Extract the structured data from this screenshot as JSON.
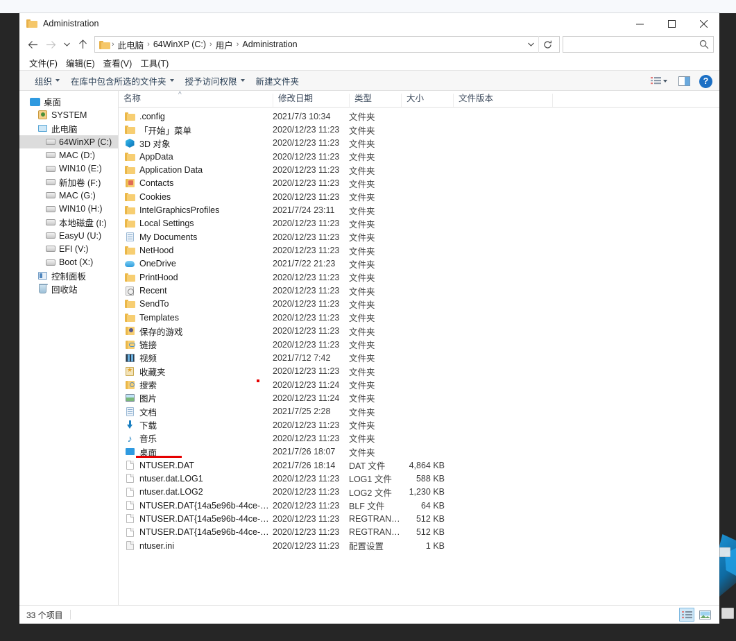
{
  "window": {
    "title": "Administration",
    "title_icon": "folder-icon",
    "controls": {
      "minimize": "minimize-icon",
      "maximize": "maximize-icon",
      "close": "close-icon"
    }
  },
  "address_bar": {
    "back": "back-arrow-icon",
    "forward": "forward-arrow-icon",
    "recent": "chevron-down-icon",
    "up": "up-arrow-icon",
    "breadcrumb": [
      "此电脑",
      "64WinXP (C:)",
      "用户",
      "Administration"
    ],
    "separator": "›",
    "dropdown": "chevron-down-icon",
    "refresh": "refresh-icon",
    "search": {
      "value": "",
      "placeholder": "",
      "icon": "search-icon"
    }
  },
  "menu_bar": [
    "文件(F)",
    "编辑(E)",
    "查看(V)",
    "工具(T)"
  ],
  "command_bar": {
    "items": [
      {
        "label": "组织",
        "has_caret": true
      },
      {
        "label": "在库中包含所选的文件夹",
        "has_caret": true
      },
      {
        "label": "授予访问权限",
        "has_caret": true
      },
      {
        "label": "新建文件夹",
        "has_caret": false
      }
    ],
    "right": {
      "view_options": "view-options-icon",
      "view_caret": "chevron-down-icon",
      "preview_pane": "preview-pane-icon",
      "help": "?"
    }
  },
  "nav_pane": {
    "items": [
      {
        "label": "桌面",
        "icon": "desktop-icon",
        "indent": 0,
        "selected": false
      },
      {
        "label": "SYSTEM",
        "icon": "user-icon",
        "indent": 1,
        "selected": false
      },
      {
        "label": "此电脑",
        "icon": "this-pc-icon",
        "indent": 1,
        "selected": false
      },
      {
        "label": "64WinXP  (C:)",
        "icon": "drive-icon",
        "indent": 2,
        "selected": true
      },
      {
        "label": "MAC (D:)",
        "icon": "drive-icon",
        "indent": 2,
        "selected": false
      },
      {
        "label": "WIN10 (E:)",
        "icon": "drive-icon",
        "indent": 2,
        "selected": false
      },
      {
        "label": "新加卷 (F:)",
        "icon": "drive-icon",
        "indent": 2,
        "selected": false
      },
      {
        "label": "MAC (G:)",
        "icon": "drive-icon",
        "indent": 2,
        "selected": false
      },
      {
        "label": "WIN10 (H:)",
        "icon": "drive-icon",
        "indent": 2,
        "selected": false
      },
      {
        "label": "本地磁盘 (I:)",
        "icon": "drive-icon",
        "indent": 2,
        "selected": false
      },
      {
        "label": "EasyU (U:)",
        "icon": "drive-icon",
        "indent": 2,
        "selected": false
      },
      {
        "label": "EFI (V:)",
        "icon": "drive-icon",
        "indent": 2,
        "selected": false
      },
      {
        "label": "Boot (X:)",
        "icon": "drive-icon",
        "indent": 2,
        "selected": false
      },
      {
        "label": "控制面板",
        "icon": "control-panel-icon",
        "indent": 1,
        "selected": false
      },
      {
        "label": "回收站",
        "icon": "recycle-bin-icon",
        "indent": 1,
        "selected": false
      }
    ]
  },
  "file_list": {
    "columns": [
      {
        "label": "名称",
        "sorted": true,
        "sort_caret": "^"
      },
      {
        "label": "修改日期",
        "sorted": false
      },
      {
        "label": "类型",
        "sorted": false
      },
      {
        "label": "大小",
        "sorted": false
      },
      {
        "label": "文件版本",
        "sorted": false
      }
    ],
    "rows": [
      {
        "name": ".config",
        "date": "2021/7/3 10:34",
        "type": "文件夹",
        "size": "",
        "version": "",
        "icon": "folder-icon"
      },
      {
        "name": "「开始」菜单",
        "date": "2020/12/23 11:23",
        "type": "文件夹",
        "size": "",
        "version": "",
        "icon": "folder-icon"
      },
      {
        "name": "3D 对象",
        "date": "2020/12/23 11:23",
        "type": "文件夹",
        "size": "",
        "version": "",
        "icon": "3d-objects-icon"
      },
      {
        "name": "AppData",
        "date": "2020/12/23 11:23",
        "type": "文件夹",
        "size": "",
        "version": "",
        "icon": "folder-icon"
      },
      {
        "name": "Application Data",
        "date": "2020/12/23 11:23",
        "type": "文件夹",
        "size": "",
        "version": "",
        "icon": "folder-icon"
      },
      {
        "name": "Contacts",
        "date": "2020/12/23 11:23",
        "type": "文件夹",
        "size": "",
        "version": "",
        "icon": "contacts-icon"
      },
      {
        "name": "Cookies",
        "date": "2020/12/23 11:23",
        "type": "文件夹",
        "size": "",
        "version": "",
        "icon": "folder-icon"
      },
      {
        "name": "IntelGraphicsProfiles",
        "date": "2021/7/24 23:11",
        "type": "文件夹",
        "size": "",
        "version": "",
        "icon": "folder-icon"
      },
      {
        "name": "Local Settings",
        "date": "2020/12/23 11:23",
        "type": "文件夹",
        "size": "",
        "version": "",
        "icon": "folder-icon"
      },
      {
        "name": "My Documents",
        "date": "2020/12/23 11:23",
        "type": "文件夹",
        "size": "",
        "version": "",
        "icon": "my-documents-icon"
      },
      {
        "name": "NetHood",
        "date": "2020/12/23 11:23",
        "type": "文件夹",
        "size": "",
        "version": "",
        "icon": "folder-icon"
      },
      {
        "name": "OneDrive",
        "date": "2021/7/22 21:23",
        "type": "文件夹",
        "size": "",
        "version": "",
        "icon": "onedrive-icon"
      },
      {
        "name": "PrintHood",
        "date": "2020/12/23 11:23",
        "type": "文件夹",
        "size": "",
        "version": "",
        "icon": "folder-icon"
      },
      {
        "name": "Recent",
        "date": "2020/12/23 11:23",
        "type": "文件夹",
        "size": "",
        "version": "",
        "icon": "recent-icon"
      },
      {
        "name": "SendTo",
        "date": "2020/12/23 11:23",
        "type": "文件夹",
        "size": "",
        "version": "",
        "icon": "folder-icon"
      },
      {
        "name": "Templates",
        "date": "2020/12/23 11:23",
        "type": "文件夹",
        "size": "",
        "version": "",
        "icon": "folder-icon"
      },
      {
        "name": "保存的游戏",
        "date": "2020/12/23 11:23",
        "type": "文件夹",
        "size": "",
        "version": "",
        "icon": "saved-games-icon"
      },
      {
        "name": "链接",
        "date": "2020/12/23 11:23",
        "type": "文件夹",
        "size": "",
        "version": "",
        "icon": "links-icon"
      },
      {
        "name": "视频",
        "date": "2021/7/12 7:42",
        "type": "文件夹",
        "size": "",
        "version": "",
        "icon": "videos-icon"
      },
      {
        "name": "收藏夹",
        "date": "2020/12/23 11:23",
        "type": "文件夹",
        "size": "",
        "version": "",
        "icon": "favorites-icon"
      },
      {
        "name": "搜索",
        "date": "2020/12/23 11:24",
        "type": "文件夹",
        "size": "",
        "version": "",
        "icon": "searches-icon"
      },
      {
        "name": "图片",
        "date": "2020/12/23 11:24",
        "type": "文件夹",
        "size": "",
        "version": "",
        "icon": "pictures-icon"
      },
      {
        "name": "文档",
        "date": "2021/7/25 2:28",
        "type": "文件夹",
        "size": "",
        "version": "",
        "icon": "documents-icon"
      },
      {
        "name": "下载",
        "date": "2020/12/23 11:23",
        "type": "文件夹",
        "size": "",
        "version": "",
        "icon": "downloads-icon"
      },
      {
        "name": "音乐",
        "date": "2020/12/23 11:23",
        "type": "文件夹",
        "size": "",
        "version": "",
        "icon": "music-icon"
      },
      {
        "name": "桌面",
        "date": "2021/7/26 18:07",
        "type": "文件夹",
        "size": "",
        "version": "",
        "icon": "desktop-folder-icon"
      },
      {
        "name": "NTUSER.DAT",
        "date": "2021/7/26 18:14",
        "type": "DAT 文件",
        "size": "4,864 KB",
        "version": "",
        "icon": "file-icon"
      },
      {
        "name": "ntuser.dat.LOG1",
        "date": "2020/12/23 11:23",
        "type": "LOG1 文件",
        "size": "588 KB",
        "version": "",
        "icon": "file-icon"
      },
      {
        "name": "ntuser.dat.LOG2",
        "date": "2020/12/23 11:23",
        "type": "LOG2 文件",
        "size": "1,230 KB",
        "version": "",
        "icon": "file-icon"
      },
      {
        "name": "NTUSER.DAT{14a5e96b-44ce-11eb-9...",
        "date": "2020/12/23 11:23",
        "type": "BLF 文件",
        "size": "64 KB",
        "version": "",
        "icon": "file-icon"
      },
      {
        "name": "NTUSER.DAT{14a5e96b-44ce-11eb-9...",
        "date": "2020/12/23 11:23",
        "type": "REGTRANS...",
        "size": "512 KB",
        "version": "",
        "icon": "file-icon"
      },
      {
        "name": "NTUSER.DAT{14a5e96b-44ce-11eb-9...",
        "date": "2020/12/23 11:23",
        "type": "REGTRANS...",
        "size": "512 KB",
        "version": "",
        "icon": "file-icon"
      },
      {
        "name": "ntuser.ini",
        "date": "2020/12/23 11:23",
        "type": "配置设置",
        "size": "1 KB",
        "version": "",
        "icon": "ini-file-icon"
      }
    ]
  },
  "status_bar": {
    "item_count": "33 个项目",
    "views": [
      {
        "name": "details-view",
        "active": true
      },
      {
        "name": "large-icons-view",
        "active": false
      }
    ]
  },
  "annotations": {
    "underline_color": "#e60000",
    "dot_color": "#e60000"
  }
}
